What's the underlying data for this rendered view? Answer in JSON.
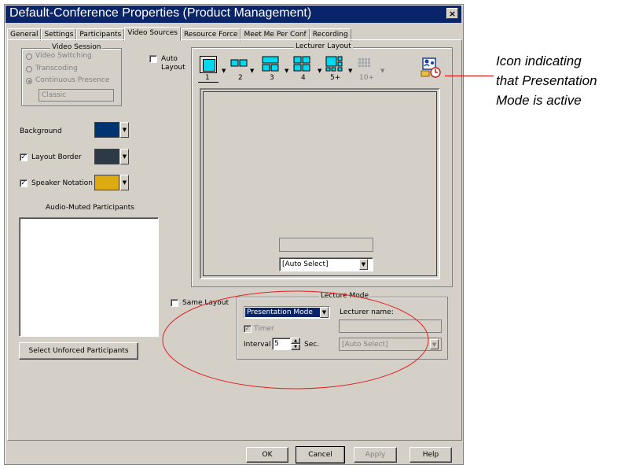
{
  "window": {
    "title": "Default-Conference Properties  (Product Management)",
    "close_glyph": "×"
  },
  "tabs": [
    {
      "label": "General",
      "active": false
    },
    {
      "label": "Settings",
      "active": false
    },
    {
      "label": "Participants",
      "active": false
    },
    {
      "label": "Video Sources",
      "active": true
    },
    {
      "label": "Resource Force",
      "active": false
    },
    {
      "label": "Meet Me Per Conf",
      "active": false
    },
    {
      "label": "Recording",
      "active": false
    }
  ],
  "video_session": {
    "group_label": "Video Session",
    "options": [
      {
        "label": "Video Switching",
        "selected": false
      },
      {
        "label": "Transcoding",
        "selected": false
      },
      {
        "label": "Continuous Presence",
        "selected": true
      }
    ],
    "classic_value": "Classic"
  },
  "auto_layout": {
    "label_line1": "Auto",
    "label_line2": "Layout",
    "checked": false
  },
  "background": {
    "label": "Background",
    "color": "#003471"
  },
  "layout_border": {
    "label": "Layout Border",
    "checked": true,
    "color": "#2c3a48"
  },
  "speaker_notation": {
    "label": "Speaker Notation",
    "checked": true,
    "color": "#ddaa11"
  },
  "audio_muted": {
    "label": "Audio-Muted Participants"
  },
  "select_unforced_button": "Select Unforced Participants",
  "lecturer_layout": {
    "group_label": "Lecturer Layout",
    "layout_buttons": [
      "1",
      "2",
      "3",
      "4",
      "5+",
      "10+"
    ],
    "auto_select": "[Auto Select]",
    "presentation_icon": "presentation-mode-icon"
  },
  "same_layout": {
    "label": "Same Layout",
    "checked": false
  },
  "lecture_mode": {
    "group_label": "Lecture Mode",
    "mode_value": "Presentation Mode",
    "lecturer_name_label": "Lecturer name:",
    "timer_label": "Timer",
    "timer_checked": true,
    "interval_label": "Interval",
    "interval_value": "5",
    "sec_label": "Sec.",
    "lecturer_select": "[Auto Select]"
  },
  "buttons": {
    "ok": "OK",
    "cancel": "Cancel",
    "apply": "Apply",
    "help": "Help"
  },
  "annotation": {
    "line1": "Icon indicating",
    "line2": "that Presentation",
    "line3": "Mode is active"
  },
  "colors": {
    "accent_titlebar": "#0a246a",
    "highlight": "#0a246a",
    "ellipse": "#e02020",
    "callout_line": "#cc0000"
  }
}
